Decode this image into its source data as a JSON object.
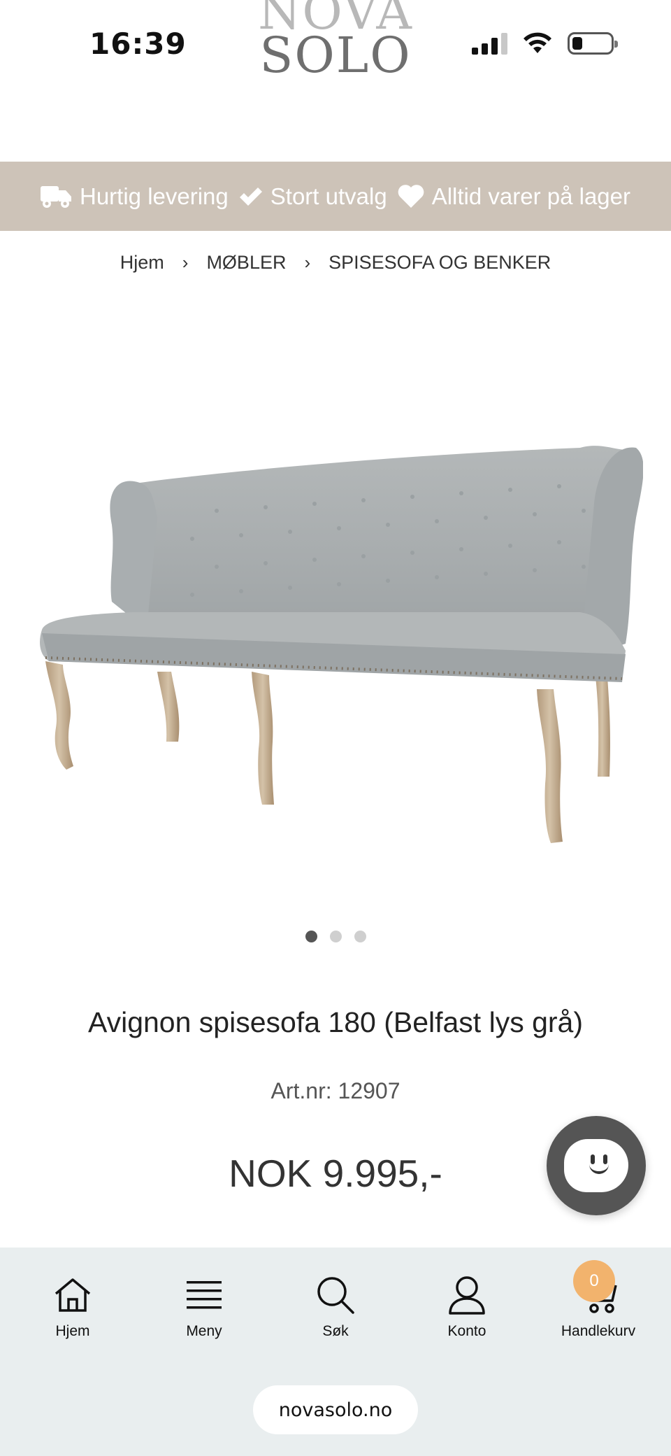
{
  "status_bar": {
    "time": "16:39",
    "signal_icon": "cellular-signal-icon",
    "wifi_icon": "wifi-icon",
    "battery_icon": "battery-low-icon",
    "battery_level": 0.2
  },
  "logo": {
    "line1": "NOVA",
    "line2": "SOLO"
  },
  "usp_bar": {
    "background": "#cdc3b8",
    "items": [
      {
        "icon": "truck-icon",
        "label": "Hurtig levering"
      },
      {
        "icon": "checkmark-icon",
        "label": "Stort utvalg"
      },
      {
        "icon": "heart-icon",
        "label": "Alltid varer på lager"
      }
    ]
  },
  "breadcrumb": {
    "items": [
      "Hjem",
      "MØBLER",
      "SPISESOFA OG BENKER"
    ],
    "separator_icon": "chevron-right-icon"
  },
  "product": {
    "image_icon": "dining-sofa-image",
    "carousel": {
      "count": 3,
      "active_index": 0
    },
    "title": "Avignon spisesofa 180 (Belfast lys grå)",
    "art_nr": "Art.nr: 12907",
    "price": "NOK 9.995,-"
  },
  "chat_widget": {
    "icon": "chat-smiley-icon",
    "color": "#555555"
  },
  "bottom_nav": {
    "background": "#e9eeef",
    "items": [
      {
        "icon": "home-icon",
        "label": "Hjem"
      },
      {
        "icon": "menu-icon",
        "label": "Meny"
      },
      {
        "icon": "search-icon",
        "label": "Søk"
      },
      {
        "icon": "account-icon",
        "label": "Konto"
      },
      {
        "icon": "cart-icon",
        "label": "Handlekurv",
        "badge": "0",
        "badge_color": "#f2b36d"
      }
    ]
  },
  "browser": {
    "url": "novasolo.no"
  }
}
